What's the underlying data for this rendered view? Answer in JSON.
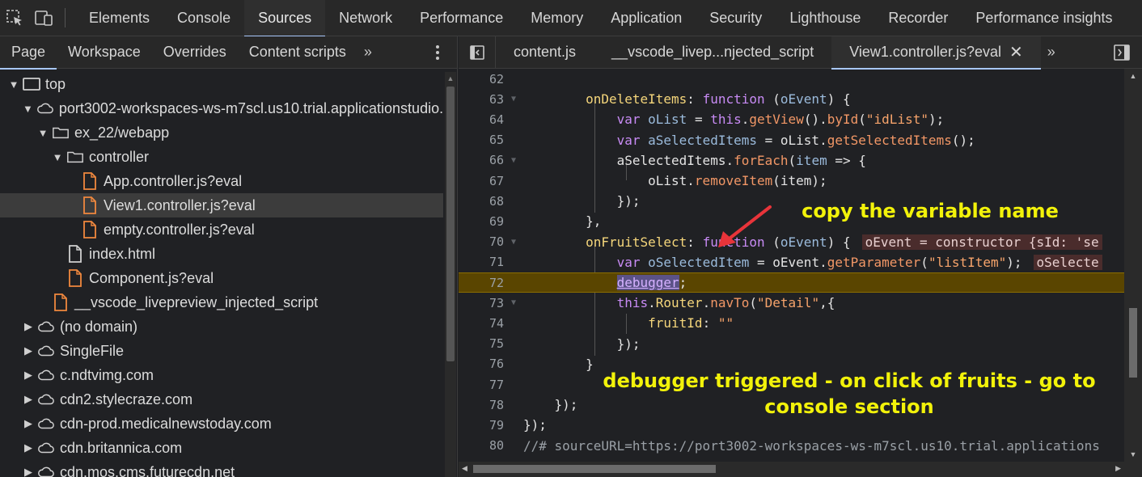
{
  "toolbar": {
    "inspect_icon": "inspect-element-icon",
    "device_icon": "device-toolbar-icon",
    "tabs": [
      "Elements",
      "Console",
      "Sources",
      "Network",
      "Performance",
      "Memory",
      "Application",
      "Security",
      "Lighthouse",
      "Recorder",
      "Performance insights"
    ],
    "active_tab": "Sources"
  },
  "navigator": {
    "tabs": [
      "Page",
      "Workspace",
      "Overrides",
      "Content scripts"
    ],
    "active_tab": "Page",
    "more": "»",
    "tree": [
      {
        "label": "top",
        "icon": "frame-icon",
        "depth": 0,
        "expanded": true
      },
      {
        "label": "port3002-workspaces-ws-m7scl.us10.trial.applicationstudio.",
        "icon": "cloud-icon",
        "depth": 1,
        "expanded": true
      },
      {
        "label": "ex_22/webapp",
        "icon": "folder-icon",
        "depth": 2,
        "expanded": true
      },
      {
        "label": "controller",
        "icon": "folder-icon",
        "depth": 3,
        "expanded": true
      },
      {
        "label": "App.controller.js?eval",
        "icon": "js-file-icon",
        "depth": 4
      },
      {
        "label": "View1.controller.js?eval",
        "icon": "js-file-icon",
        "depth": 4,
        "selected": true
      },
      {
        "label": "empty.controller.js?eval",
        "icon": "js-file-icon",
        "depth": 4
      },
      {
        "label": "index.html",
        "icon": "document-icon",
        "depth": 3
      },
      {
        "label": "Component.js?eval",
        "icon": "js-file-icon",
        "depth": 3
      },
      {
        "label": "__vscode_livepreview_injected_script",
        "icon": "js-file-icon",
        "depth": 2
      },
      {
        "label": "(no domain)",
        "icon": "cloud-icon",
        "depth": 1,
        "expanded": false
      },
      {
        "label": "SingleFile",
        "icon": "cloud-icon",
        "depth": 1,
        "expanded": false
      },
      {
        "label": "c.ndtvimg.com",
        "icon": "cloud-icon",
        "depth": 1,
        "expanded": false
      },
      {
        "label": "cdn2.stylecraze.com",
        "icon": "cloud-icon",
        "depth": 1,
        "expanded": false
      },
      {
        "label": "cdn-prod.medicalnewstoday.com",
        "icon": "cloud-icon",
        "depth": 1,
        "expanded": false
      },
      {
        "label": "cdn.britannica.com",
        "icon": "cloud-icon",
        "depth": 1,
        "expanded": false
      },
      {
        "label": "cdn.mos.cms.futurecdn.net",
        "icon": "cloud-icon",
        "depth": 1,
        "expanded": false
      }
    ]
  },
  "editor": {
    "tabs": [
      "content.js",
      "__vscode_livep...njected_script",
      "View1.controller.js?eval"
    ],
    "active_tab": "View1.controller.js?eval",
    "close_glyph": "✕",
    "more": "»",
    "paused_line": 72,
    "lines": [
      {
        "n": "62",
        "html": ""
      },
      {
        "n": "63",
        "html": "        <span class='prop'>onDeleteItems</span>: <span class='kw'>function</span> (<span class='varn'>oEvent</span>) {"
      },
      {
        "n": "64",
        "html": "            <span class='kw'>var</span> <span class='varn'>oList</span> = <span class='kw'>this</span>.<span class='fn'>getView</span>().<span class='fn'>byId</span>(<span class='str'>\"idList\"</span>);"
      },
      {
        "n": "65",
        "html": "            <span class='kw'>var</span> <span class='varn'>aSelectedItems</span> = oList.<span class='fn'>getSelectedItems</span>();"
      },
      {
        "n": "66",
        "html": "            aSelectedItems.<span class='fn'>forEach</span>(<span class='varn'>item</span> => {"
      },
      {
        "n": "67",
        "html": "                oList.<span class='fn'>removeItem</span>(item);"
      },
      {
        "n": "68",
        "html": "            });"
      },
      {
        "n": "69",
        "html": "        },"
      },
      {
        "n": "70",
        "html": "        <span class='prop'>onFruitSelect</span>: <span class='kw'>function</span> (<span class='varn'>oEvent</span>) {<span class='inline-val'>oEvent = constructor {sId: 'se</span>"
      },
      {
        "n": "71",
        "html": "            <span class='kw'>var</span> <span class='varn'>oSelectedItem</span> = oEvent.<span class='fn'>getParameter</span>(<span class='str'>\"listItem\"</span>);<span class='inline-val'>oSelecte</span>"
      },
      {
        "n": "72",
        "html": "            <span class='hl-debugger'>debugger</span>;"
      },
      {
        "n": "73",
        "html": "            <span class='kw'>this</span>.<span class='prop'>Router</span>.<span class='fn'>navTo</span>(<span class='str'>\"Detail\"</span>,{"
      },
      {
        "n": "74",
        "html": "                <span class='prop'>fruitId</span>: <span class='str'>\"\"</span>"
      },
      {
        "n": "75",
        "html": "            });"
      },
      {
        "n": "76",
        "html": "        }"
      },
      {
        "n": "77",
        "html": ""
      },
      {
        "n": "78",
        "html": "    });"
      },
      {
        "n": "79",
        "html": "});"
      },
      {
        "n": "80",
        "html": "<span class='cmt'>//# sourceURL=https://port3002-workspaces-ws-m7scl.us10.trial.applications</span>"
      }
    ]
  },
  "annotations": {
    "copy_hint": "copy the variable name",
    "debugger_hint_line1": "debugger triggered - on click of fruits - go to",
    "debugger_hint_line2": "console section"
  },
  "colors": {
    "annotation": "#f2f20a",
    "arrow": "#e8343a",
    "paused_line": "#5a4500",
    "js_file_icon": "#f0883e"
  }
}
